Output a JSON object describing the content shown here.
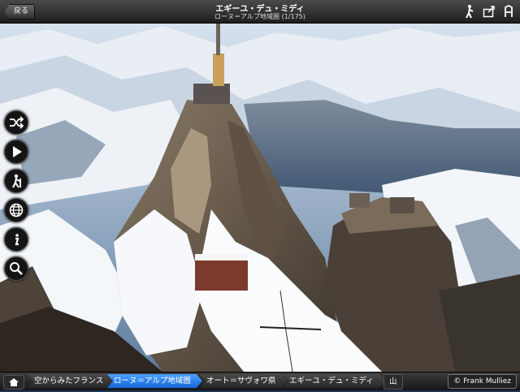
{
  "header": {
    "back_label": "戻る",
    "title": "エギーユ・デュ・ミディ",
    "subtitle": "ローヌ＝アルプ地域圏 (1/175)",
    "icons": [
      "hiker-icon",
      "share-icon",
      "font-icon"
    ]
  },
  "side_buttons": [
    "shuffle-icon",
    "play-icon",
    "hiker-icon",
    "globe-icon",
    "info-icon",
    "search-icon"
  ],
  "breadcrumbs": [
    {
      "label": "空からみたフランス",
      "active": false
    },
    {
      "label": "ローヌ＝アルプ地域圏",
      "active": true
    },
    {
      "label": "オート＝サヴォワ県",
      "active": false
    },
    {
      "label": "エギーユ・デュ・ミディ",
      "active": false
    }
  ],
  "tag_label": "山",
  "credit": "© Frank Mulliez",
  "colors": {
    "active_crumb": "#1f7ff0",
    "bar": "#262626"
  }
}
